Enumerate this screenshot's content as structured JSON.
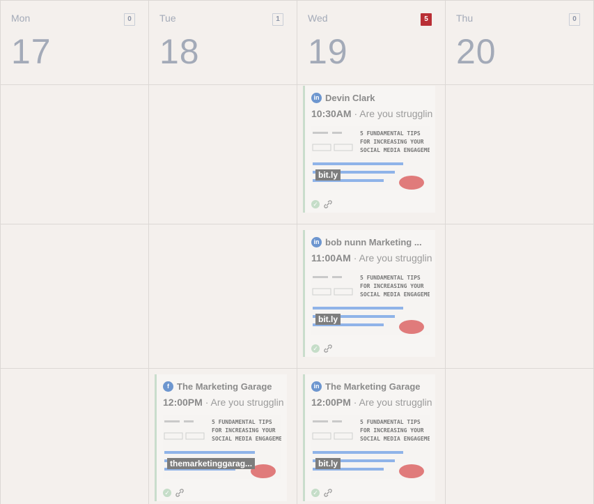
{
  "days": [
    {
      "name": "Mon",
      "number": "17",
      "count": "0"
    },
    {
      "name": "Tue",
      "number": "18",
      "count": "1"
    },
    {
      "name": "Wed",
      "number": "19",
      "count": "5"
    },
    {
      "name": "Thu",
      "number": "20",
      "count": "0"
    }
  ],
  "colors": {
    "accent_hot": "#b92f35",
    "approved": "#c9ddcc",
    "network": "#6d96cf"
  },
  "thumbnail": {
    "title_line1": "5 FUNDAMENTAL TIPS",
    "title_line2": "FOR INCREASING YOUR",
    "title_line3": "SOCIAL MEDIA ENGAGEMENT:"
  },
  "posts": [
    {
      "network_icon": "linkedin-icon",
      "network_glyph": "in",
      "account": "Devin Clark",
      "time": "10:30AM",
      "text": " · Are you struggling",
      "link": "bit.ly"
    },
    {
      "network_icon": "linkedin-icon",
      "network_glyph": "in",
      "account": "bob nunn Marketing ...",
      "time": "11:00AM",
      "text": " · Are you struggling",
      "link": "bit.ly"
    },
    {
      "network_icon": "facebook-icon",
      "network_glyph": "f",
      "account": "The Marketing Garage",
      "time": "12:00PM",
      "text": " · Are you struggling",
      "link": "themarketinggarag..."
    },
    {
      "network_icon": "linkedin-icon",
      "network_glyph": "in",
      "account": "The Marketing Garage",
      "time": "12:00PM",
      "text": " · Are you struggling",
      "link": "bit.ly"
    }
  ]
}
